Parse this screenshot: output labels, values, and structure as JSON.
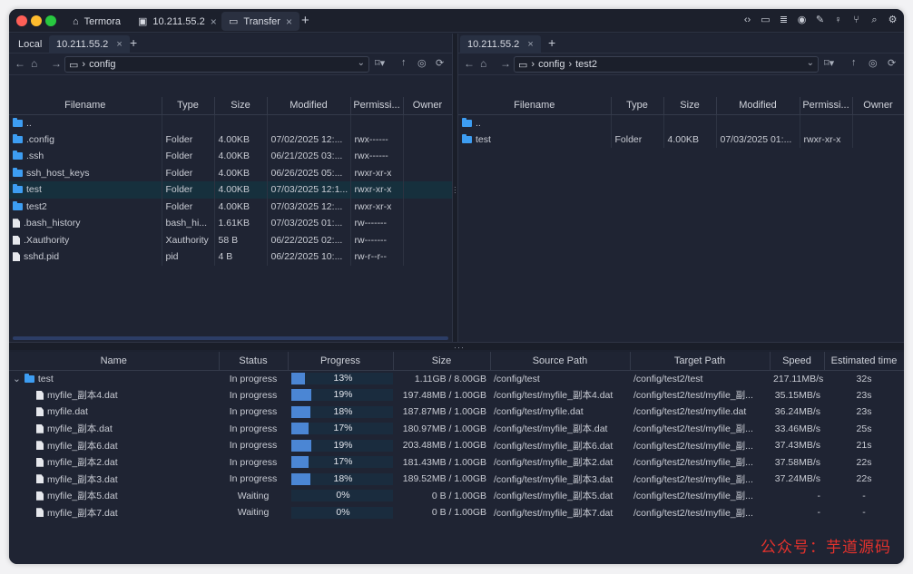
{
  "titlebar": {
    "tabs": [
      {
        "label": "Termora",
        "icon": "home-icon"
      },
      {
        "label": "10.211.55.2",
        "icon": "terminal-icon",
        "close": "×"
      },
      {
        "label": "Transfer",
        "icon": "folder-icon",
        "close": "×"
      }
    ],
    "new_tab": "+",
    "toolbar_icons": [
      "code-icon",
      "folder-icon",
      "notes-icon",
      "record-icon",
      "pencil-icon",
      "key-icon",
      "branch-icon",
      "search-icon",
      "gear-icon"
    ]
  },
  "left_pane": {
    "tabs": [
      {
        "label": "Local"
      },
      {
        "label": "10.211.55.2",
        "close": "×"
      }
    ],
    "new_tab": "+",
    "path": {
      "segments": [
        "config"
      ]
    },
    "columns": [
      "Filename",
      "Type",
      "Size",
      "Modified",
      "Permissi...",
      "Owner"
    ],
    "rows": [
      {
        "name": "..",
        "kind": "folder",
        "type": "",
        "size": "",
        "modified": "",
        "perm": "",
        "owner": ""
      },
      {
        "name": ".config",
        "kind": "folder",
        "type": "Folder",
        "size": "4.00KB",
        "modified": "07/02/2025 12:...",
        "perm": "rwx------",
        "owner": ""
      },
      {
        "name": ".ssh",
        "kind": "folder",
        "type": "Folder",
        "size": "4.00KB",
        "modified": "06/21/2025 03:...",
        "perm": "rwx------",
        "owner": ""
      },
      {
        "name": "ssh_host_keys",
        "kind": "folder",
        "type": "Folder",
        "size": "4.00KB",
        "modified": "06/26/2025 05:...",
        "perm": "rwxr-xr-x",
        "owner": ""
      },
      {
        "name": "test",
        "kind": "folder",
        "type": "Folder",
        "size": "4.00KB",
        "modified": "07/03/2025 12:1...",
        "perm": "rwxr-xr-x",
        "owner": "",
        "selected": true
      },
      {
        "name": "test2",
        "kind": "folder",
        "type": "Folder",
        "size": "4.00KB",
        "modified": "07/03/2025 12:...",
        "perm": "rwxr-xr-x",
        "owner": ""
      },
      {
        "name": ".bash_history",
        "kind": "file",
        "type": "bash_hi...",
        "size": "1.61KB",
        "modified": "07/03/2025 01:...",
        "perm": "rw-------",
        "owner": ""
      },
      {
        "name": ".Xauthority",
        "kind": "file",
        "type": "Xauthority",
        "size": "58 B",
        "modified": "06/22/2025 02:...",
        "perm": "rw-------",
        "owner": ""
      },
      {
        "name": "sshd.pid",
        "kind": "file",
        "type": "pid",
        "size": "4 B",
        "modified": "06/22/2025 10:...",
        "perm": "rw-r--r--",
        "owner": ""
      }
    ]
  },
  "right_pane": {
    "tabs": [
      {
        "label": "10.211.55.2",
        "close": "×"
      }
    ],
    "new_tab": "+",
    "path": {
      "segments": [
        "config",
        "test2"
      ]
    },
    "columns": [
      "Filename",
      "Type",
      "Size",
      "Modified",
      "Permissi...",
      "Owner"
    ],
    "rows": [
      {
        "name": "..",
        "kind": "folder",
        "type": "",
        "size": "",
        "modified": "",
        "perm": "",
        "owner": ""
      },
      {
        "name": "test",
        "kind": "folder",
        "type": "Folder",
        "size": "4.00KB",
        "modified": "07/03/2025 01:...",
        "perm": "rwxr-xr-x",
        "owner": ""
      }
    ]
  },
  "queue": {
    "columns": [
      "Name",
      "Status",
      "Progress",
      "Size",
      "Source Path",
      "Target Path",
      "Speed",
      "Estimated time"
    ],
    "rows": [
      {
        "name": "test",
        "kind": "folder",
        "status": "In progress",
        "progress": 0.13,
        "progress_label": "13%",
        "size": "1.11GB / 8.00GB",
        "source": "/config/test",
        "target": "/config/test2/test",
        "speed": "217.11MB/s",
        "eta": "32s"
      },
      {
        "name": "myfile_副本4.dat",
        "kind": "file",
        "status": "In progress",
        "progress": 0.19,
        "progress_label": "19%",
        "size": "197.48MB / 1.00GB",
        "source": "/config/test/myfile_副本4.dat",
        "target": "/config/test2/test/myfile_副...",
        "speed": "35.15MB/s",
        "eta": "23s"
      },
      {
        "name": "myfile.dat",
        "kind": "file",
        "status": "In progress",
        "progress": 0.18,
        "progress_label": "18%",
        "size": "187.87MB / 1.00GB",
        "source": "/config/test/myfile.dat",
        "target": "/config/test2/test/myfile.dat",
        "speed": "36.24MB/s",
        "eta": "23s"
      },
      {
        "name": "myfile_副本.dat",
        "kind": "file",
        "status": "In progress",
        "progress": 0.17,
        "progress_label": "17%",
        "size": "180.97MB / 1.00GB",
        "source": "/config/test/myfile_副本.dat",
        "target": "/config/test2/test/myfile_副...",
        "speed": "33.46MB/s",
        "eta": "25s"
      },
      {
        "name": "myfile_副本6.dat",
        "kind": "file",
        "status": "In progress",
        "progress": 0.19,
        "progress_label": "19%",
        "size": "203.48MB / 1.00GB",
        "source": "/config/test/myfile_副本6.dat",
        "target": "/config/test2/test/myfile_副...",
        "speed": "37.43MB/s",
        "eta": "21s"
      },
      {
        "name": "myfile_副本2.dat",
        "kind": "file",
        "status": "In progress",
        "progress": 0.17,
        "progress_label": "17%",
        "size": "181.43MB / 1.00GB",
        "source": "/config/test/myfile_副本2.dat",
        "target": "/config/test2/test/myfile_副...",
        "speed": "37.58MB/s",
        "eta": "22s"
      },
      {
        "name": "myfile_副本3.dat",
        "kind": "file",
        "status": "In progress",
        "progress": 0.18,
        "progress_label": "18%",
        "size": "189.52MB / 1.00GB",
        "source": "/config/test/myfile_副本3.dat",
        "target": "/config/test2/test/myfile_副...",
        "speed": "37.24MB/s",
        "eta": "22s"
      },
      {
        "name": "myfile_副本5.dat",
        "kind": "file",
        "status": "Waiting",
        "progress": 0,
        "progress_label": "0%",
        "size": "0 B / 1.00GB",
        "source": "/config/test/myfile_副本5.dat",
        "target": "/config/test2/test/myfile_副...",
        "speed": "-",
        "eta": "-"
      },
      {
        "name": "myfile_副本7.dat",
        "kind": "file",
        "status": "Waiting",
        "progress": 0,
        "progress_label": "0%",
        "size": "0 B / 1.00GB",
        "source": "/config/test/myfile_副本7.dat",
        "target": "/config/test2/test/myfile_副...",
        "speed": "-",
        "eta": "-"
      }
    ]
  },
  "watermark": "公众号：芋道源码",
  "colors": {
    "window_bg": "#1d2230",
    "folder": "#3d9df2",
    "progress_fill": "#4b86d4",
    "selected_row": "#16303d",
    "watermark": "#e3322d"
  }
}
